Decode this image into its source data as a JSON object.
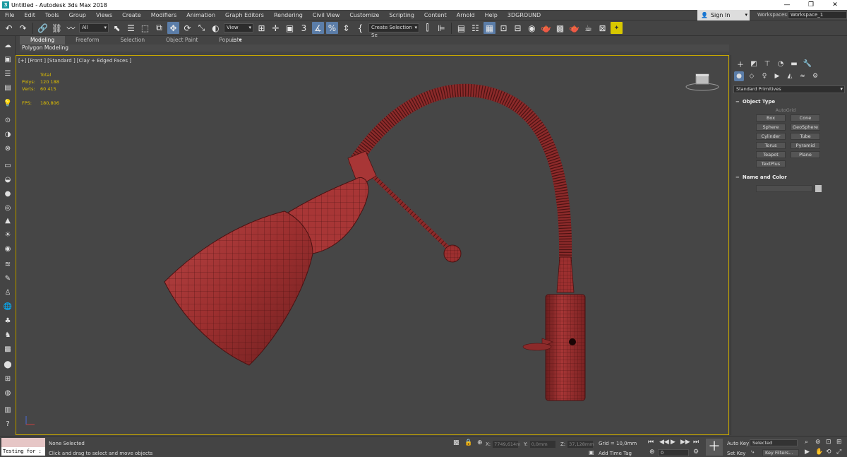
{
  "window": {
    "title": "Untitled - Autodesk 3ds Max 2018",
    "app_icon_letter": "3",
    "minimize": "—",
    "maximize": "❐",
    "close": "✕"
  },
  "menu": {
    "items": [
      "File",
      "Edit",
      "Tools",
      "Group",
      "Views",
      "Create",
      "Modifiers",
      "Animation",
      "Graph Editors",
      "Rendering",
      "Civil View",
      "Customize",
      "Scripting",
      "Content",
      "Arnold",
      "Help",
      "3DGROUND"
    ],
    "signin": "Sign In",
    "workspaces_label": "Workspaces:",
    "workspace_value": "Workspace_1"
  },
  "toolbar": {
    "filter": "All",
    "ref_coord": "View",
    "selection_set": "Create Selection Se"
  },
  "ribbon": {
    "tabs": [
      "Modeling",
      "Freeform",
      "Selection",
      "Object Paint",
      "Populate"
    ],
    "active_tab": "Modeling",
    "subpanel": "Polygon Modeling"
  },
  "viewport": {
    "label": "[+] [Front ] [Standard ] [Clay + Edged Faces ]",
    "stats_header": "Total",
    "polys_label": "Polys:",
    "polys_value": "120 188",
    "verts_label": "Verts:",
    "verts_value": "60 415",
    "fps_label": "FPS:",
    "fps_value": "180,806",
    "model_color": "#9c2f2f"
  },
  "command_panel": {
    "primitive_type": "Standard Primitives",
    "object_type_header": "Object Type",
    "autogrid": "AutoGrid",
    "objects": [
      "Box",
      "Cone",
      "Sphere",
      "GeoSphere",
      "Cylinder",
      "Tube",
      "Torus",
      "Pyramid",
      "Teapot",
      "Plane",
      "TextPlus"
    ],
    "name_color_header": "Name and Color"
  },
  "status": {
    "maxscript_value": "Testing for :",
    "selection": "None Selected",
    "prompt": "Click and drag to select and move objects",
    "x_label": "X:",
    "x_value": "7749,614m",
    "y_label": "Y:",
    "y_value": "0,0mm",
    "z_label": "Z:",
    "z_value": "37,128mm",
    "grid": "Grid = 10,0mm",
    "add_time_tag": "Add Time Tag",
    "auto_key": "Auto Key",
    "set_key": "Set Key",
    "selected_mode": "Selected",
    "key_filters": "Key Filters...",
    "frame": "0"
  }
}
